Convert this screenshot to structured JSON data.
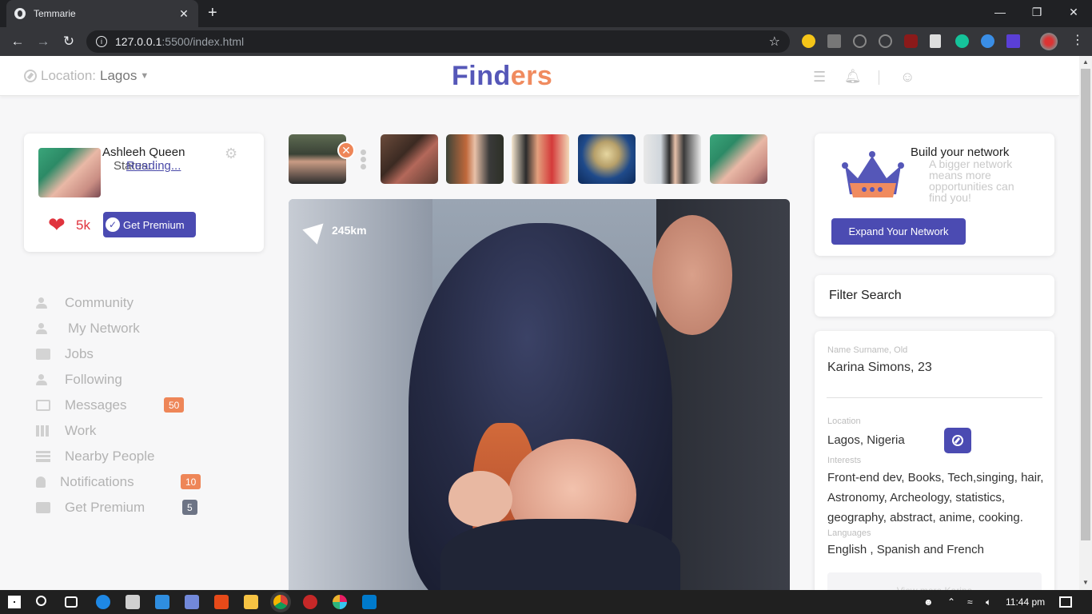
{
  "browser": {
    "tab_title": "Temmarie",
    "url_host": "127.0.0.1",
    "url_path": ":5500/index.html",
    "new_tab": "+",
    "tab_close": "✕"
  },
  "header": {
    "location_label": "Location:",
    "location_value": "Lagos",
    "brand_part1": "Find",
    "brand_part2": "ers"
  },
  "profile": {
    "name": "Ashleeh Queen",
    "status_label": "Status:",
    "status_value": "Reading...",
    "likes": "5k",
    "premium_label": "Get Premium"
  },
  "sidebar": {
    "items": [
      {
        "label": "Community",
        "icon": "community-icon"
      },
      {
        "label": "My Network",
        "icon": "network-icon"
      },
      {
        "label": "Jobs",
        "icon": "jobs-icon"
      },
      {
        "label": "Following",
        "icon": "following-icon"
      },
      {
        "label": "Messages",
        "icon": "mail-icon",
        "badge": "50"
      },
      {
        "label": "Work",
        "icon": "grid-icon"
      },
      {
        "label": "Nearby People",
        "icon": "layers-icon"
      },
      {
        "label": "Notifications",
        "icon": "bell-icon",
        "badge": "10"
      },
      {
        "label": "Get Premium",
        "icon": "gift-icon",
        "badge": "5"
      }
    ]
  },
  "stories": {
    "close_symbol": "✕"
  },
  "feed": {
    "distance": "245km"
  },
  "network": {
    "title": "Build your network",
    "subtitle": "A bigger network means more opportunities can find you!",
    "button": "Expand Your Network"
  },
  "filter": {
    "title": "Filter Search"
  },
  "details": {
    "name_label": "Name Surname, Old",
    "name_value": "Karina Simons, 23",
    "location_label": "Location",
    "location_value": "Lagos, Nigeria",
    "interests_label": "Interests",
    "interests_value": "Front-end dev, Books, Tech,singing, hair, Astronomy, Archeology, statistics, geography, abstract, anime, cooking.",
    "languages_label": "Languages",
    "languages_value": "English , Spanish and French",
    "view_more": "View more Karina"
  },
  "taskbar": {
    "time": "11:44 pm"
  },
  "colors": {
    "accent": "#4b4bb2",
    "brand_purple": "#5557b8",
    "brand_orange": "#f08b5f",
    "badge_orange": "#ee8658",
    "badge_gray": "#6d7485",
    "heart_red": "#e0333d"
  }
}
